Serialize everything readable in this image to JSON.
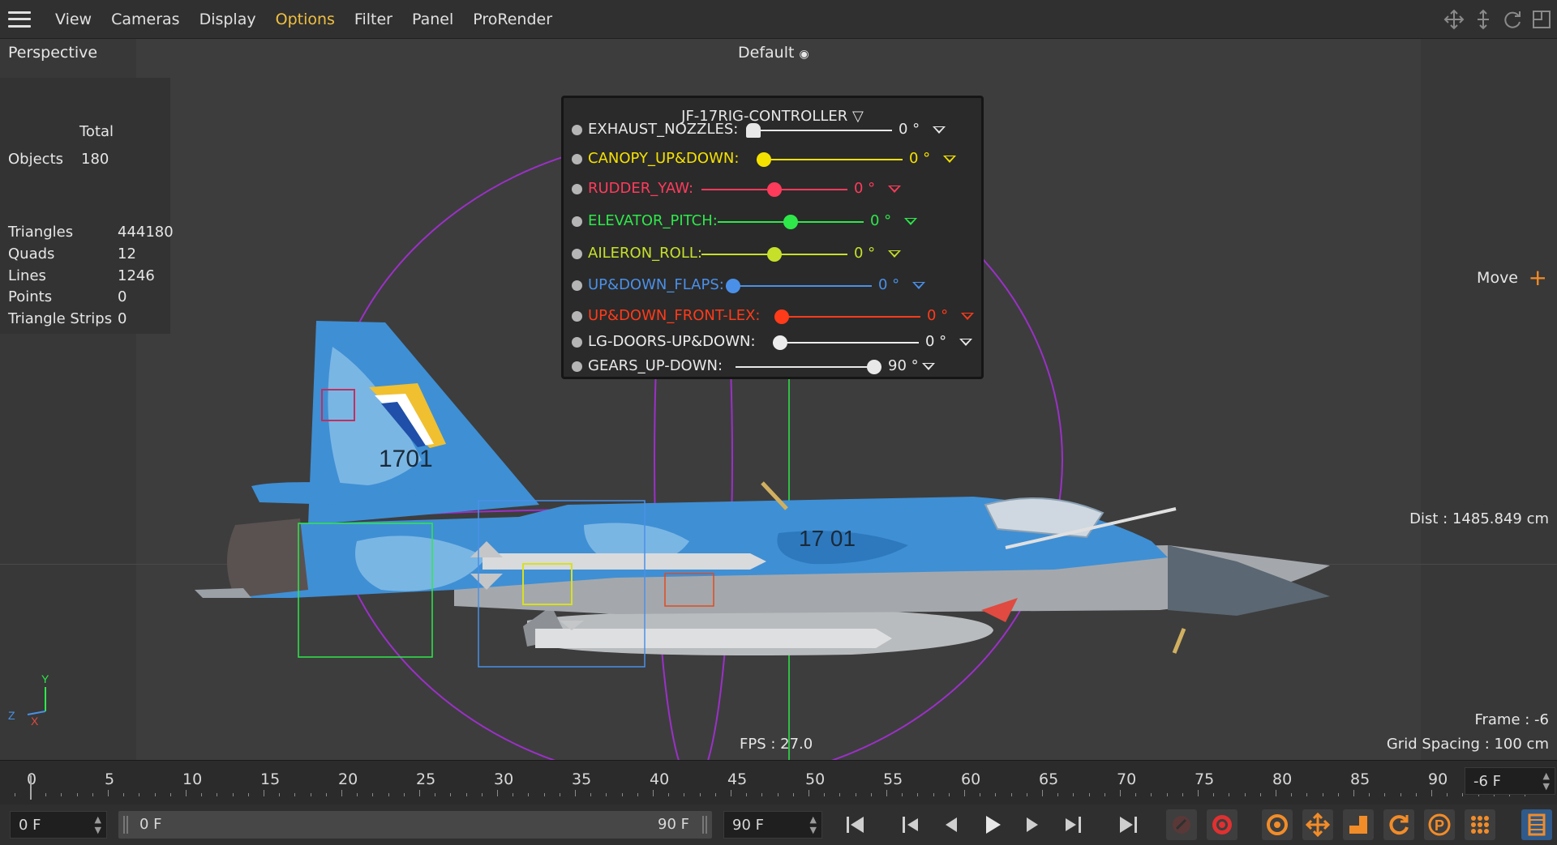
{
  "menu": {
    "items": [
      {
        "label": "View",
        "active": false
      },
      {
        "label": "Cameras",
        "active": false
      },
      {
        "label": "Display",
        "active": false
      },
      {
        "label": "Options",
        "active": true
      },
      {
        "label": "Filter",
        "active": false
      },
      {
        "label": "Panel",
        "active": false
      },
      {
        "label": "ProRender",
        "active": false
      }
    ],
    "nav_icons": [
      "move-view-icon",
      "dolly-view-icon",
      "rotate-view-icon",
      "toggle-view-icon"
    ]
  },
  "viewport": {
    "title": "Perspective",
    "camera": "Default",
    "stats": {
      "total_label": "Total",
      "rows": [
        {
          "label": "Objects",
          "value": "180"
        },
        {
          "label": "Triangles",
          "value": "444180"
        },
        {
          "label": "Quads",
          "value": "12"
        },
        {
          "label": "Lines",
          "value": "1246"
        },
        {
          "label": "Points",
          "value": "0"
        },
        {
          "label": "Triangle Strips",
          "value": "0"
        }
      ]
    },
    "tool_label": "Move",
    "dist": "Dist : 1485.849 cm",
    "frame": "Frame : -6",
    "grid_spacing": "Grid Spacing : 100 cm",
    "fps": "FPS : 27.0",
    "axis": {
      "y": "Y",
      "z": "Z",
      "x": "X"
    },
    "aircraft": {
      "tail_number": "1701",
      "fuselage_number": "17 01"
    }
  },
  "rig": {
    "title": "JF-17RIG-CONTROLLER",
    "controls": [
      {
        "name": "EXHAUST_NOZZLES:",
        "value": "0 °",
        "color": "#e8e8e8",
        "fraction": 0.0
      },
      {
        "name": "CANOPY_UP&DOWN:",
        "value": "0 °",
        "color": "#f5e100",
        "fraction": 0.0
      },
      {
        "name": "RUDDER_YAW:",
        "value": "0 °",
        "color": "#ff3b5c",
        "fraction": 0.5
      },
      {
        "name": "ELEVATOR_PITCH:",
        "value": "0 °",
        "color": "#2ee84a",
        "fraction": 0.5
      },
      {
        "name": "AILERON_ROLL:",
        "value": "0 °",
        "color": "#c6e02a",
        "fraction": 0.5
      },
      {
        "name": "UP&DOWN_FLAPS:",
        "value": "0 °",
        "color": "#4a90e8",
        "fraction": 0.0
      },
      {
        "name": "UP&DOWN_FRONT-LEX:",
        "value": "0 °",
        "color": "#ff3b1a",
        "fraction": 0.0
      },
      {
        "name": "LG-DOORS-UP&DOWN:",
        "value": "0 °",
        "color": "#ececec",
        "fraction": 0.0
      },
      {
        "name": "GEARS_UP-DOWN:",
        "value": "90 °",
        "color": "#e8e8e8",
        "fraction": 1.0
      }
    ]
  },
  "timeline": {
    "ticks": [
      "0",
      "5",
      "10",
      "15",
      "20",
      "25",
      "30",
      "35",
      "40",
      "45",
      "50",
      "55",
      "60",
      "65",
      "70",
      "75",
      "80",
      "85",
      "90"
    ],
    "current_frame": "-6 F"
  },
  "transport": {
    "start_field": "0 F",
    "range_start": "0 F",
    "range_end": "90 F",
    "end_field": "90 F",
    "buttons": [
      "go-to-start-icon",
      "previous-key-icon",
      "previous-frame-icon",
      "play-icon",
      "next-frame-icon",
      "next-key-icon",
      "go-to-end-icon",
      "autokey-icon",
      "record-icon",
      "keyframe-selection-icon",
      "record-position-icon",
      "record-scale-icon",
      "record-rotation-icon",
      "record-parameter-icon",
      "record-point-level-icon",
      "timeline-window-icon"
    ]
  }
}
